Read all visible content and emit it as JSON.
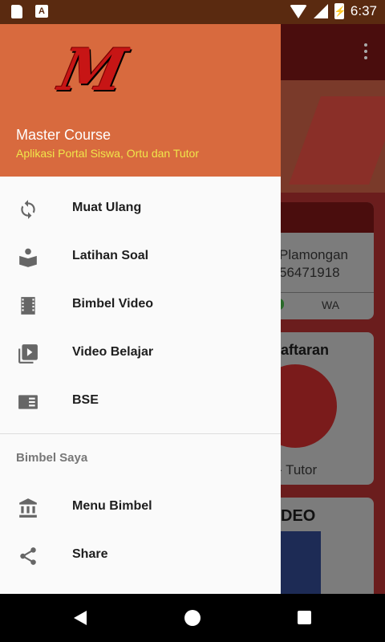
{
  "status_bar": {
    "time": "6:37",
    "notification_icons": [
      "sd-card-icon",
      "a-icon"
    ],
    "battery_glyph": "⚡"
  },
  "drawer": {
    "header": {
      "logo_letter": "M",
      "app_name": "Master Course",
      "subtitle": "Aplikasi Portal Siswa, Ortu dan Tutor",
      "colors": {
        "header_bg": "#d86a3e",
        "subtitle": "#f0e64a"
      }
    },
    "items": [
      {
        "label": "Muat Ulang",
        "icon": "refresh-icon"
      },
      {
        "label": "Latihan Soal",
        "icon": "book-reader-icon"
      },
      {
        "label": "Bimbel Video",
        "icon": "film-icon"
      },
      {
        "label": "Video Belajar",
        "icon": "video-library-icon"
      },
      {
        "label": "BSE",
        "icon": "book-icon"
      }
    ],
    "section_title": "Bimbel Saya",
    "section_items": [
      {
        "label": "Menu Bimbel",
        "icon": "bank-icon"
      },
      {
        "label": "Share",
        "icon": "share-icon"
      }
    ]
  },
  "background": {
    "card1": {
      "line1": "Plamongan",
      "line2": "56471918",
      "action": "WA"
    },
    "card2": {
      "title": "aftaran",
      "bottom": "- Tutor"
    },
    "card3": {
      "title": "DEO"
    }
  }
}
